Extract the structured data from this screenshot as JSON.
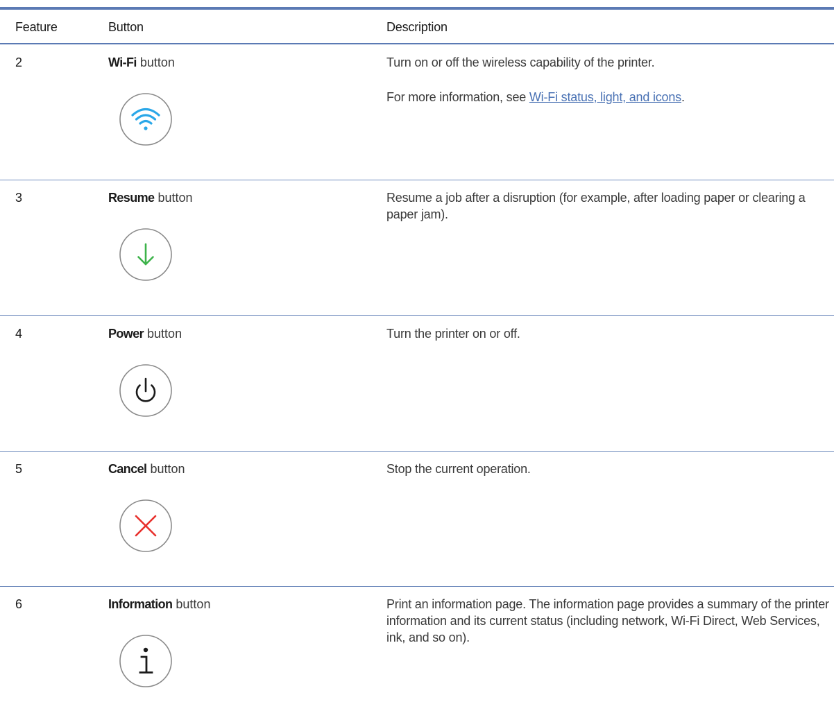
{
  "table": {
    "headers": [
      "Feature",
      "Button",
      "Description"
    ],
    "rows": [
      {
        "feature": "2",
        "button_name": "Wi-Fi",
        "button_suffix": " button",
        "icon": "wifi-icon",
        "icon_color": "#2aa7e8",
        "description": [
          "Turn on or off the wireless capability of the printer."
        ],
        "more_info_prefix": "For more information, see ",
        "more_info_link": "Wi-Fi status, light, and icons",
        "more_info_suffix": "."
      },
      {
        "feature": "3",
        "button_name": "Resume",
        "button_suffix": " button",
        "icon": "arrow-down-icon",
        "icon_color": "#3db34a",
        "description": [
          "Resume a job after a disruption (for example, after loading paper or clearing a paper jam)."
        ]
      },
      {
        "feature": "4",
        "button_name": "Power",
        "button_suffix": " button",
        "icon": "power-icon",
        "icon_color": "#1a1a1a",
        "description": [
          "Turn the printer on or off."
        ]
      },
      {
        "feature": "5",
        "button_name": "Cancel",
        "button_suffix": " button",
        "icon": "cancel-x-icon",
        "icon_color": "#e8302c",
        "description": [
          "Stop the current operation."
        ]
      },
      {
        "feature": "6",
        "button_name": "Information",
        "button_suffix": " button",
        "icon": "info-icon",
        "icon_color": "#1a1a1a",
        "description": [
          "Print an information page. The information page provides a summary of the printer information and its current status (including network, Wi-Fi Direct, Web Services, ink, and so on)."
        ]
      }
    ]
  },
  "colors": {
    "rule": "#5b7ab4",
    "link": "#4a72b4",
    "icon_border": "#8a8a8a"
  }
}
